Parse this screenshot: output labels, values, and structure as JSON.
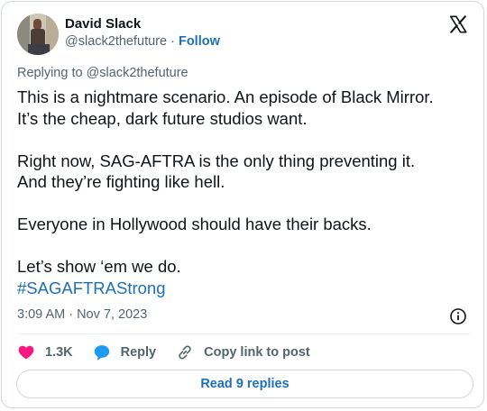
{
  "author": {
    "name": "David Slack",
    "handle": "@slack2thefuture",
    "separator": "·",
    "follow_label": "Follow"
  },
  "reply_context": "Replying to @slack2thefuture",
  "tweet": {
    "lines": [
      "This is a nightmare scenario. An episode of Black Mirror.",
      "It’s the cheap, dark future studios want.",
      "Right now, SAG-AFTRA is the only thing preventing it.",
      "And they’re fighting like hell.",
      "Everyone in Hollywood should have their backs.",
      "Let’s show ‘em we do."
    ],
    "hashtag": "#SAGAFTRAStrong"
  },
  "timestamp": "3:09 AM · Nov 7, 2023",
  "actions": {
    "like_count": "1.3K",
    "reply_label": "Reply",
    "copy_link_label": "Copy link to post"
  },
  "read_replies_label": "Read 9 replies",
  "colors": {
    "accent": "#1d6fb8",
    "like": "#f91880",
    "reply": "#1d9bf0",
    "muted": "#536471",
    "border": "#cfd9de"
  },
  "icons": [
    "x-logo-icon",
    "info-icon",
    "heart-icon",
    "reply-bubble-icon",
    "link-icon"
  ]
}
